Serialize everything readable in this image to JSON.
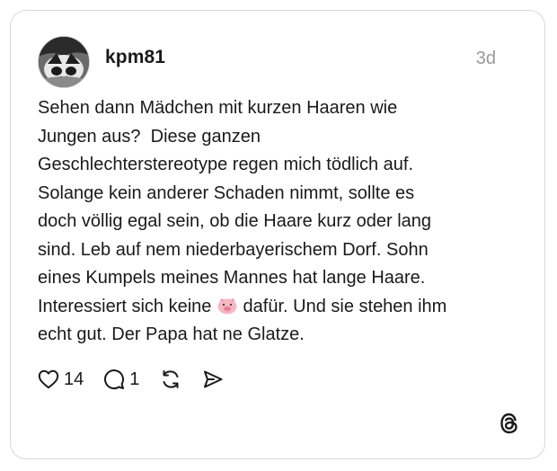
{
  "post": {
    "username": "kpm81",
    "timestamp": "3d",
    "text_before_emoji": "Sehen dann Mädchen mit kurzen Haaren wie\nJungen aus?  Diese ganzen\nGeschlechterstereotype regen mich tödlich auf.\nSolange kein anderer Schaden nimmt, sollte es\ndoch völlig egal sein, ob die Haare kurz oder lang\nsind. Leb auf nem niederbayerischem Dorf. Sohn\neines Kumpels meines Mannes hat lange Haare.\nInteressiert sich keine ",
    "emoji": "pig-face-emoji",
    "text_after_emoji": " dafür. Und sie stehen ihm\necht gut. Der Papa hat ne Glatze."
  },
  "actions": {
    "like_count": "14",
    "reply_count": "1"
  },
  "icons": {
    "like": "heart-icon",
    "reply": "speech-bubble-icon",
    "repost": "repost-arrows-icon",
    "share": "send-icon",
    "brand": "threads-logo-icon"
  },
  "colors": {
    "text": "#1a1a1a",
    "muted": "#999999",
    "border": "#d9d9d9"
  }
}
